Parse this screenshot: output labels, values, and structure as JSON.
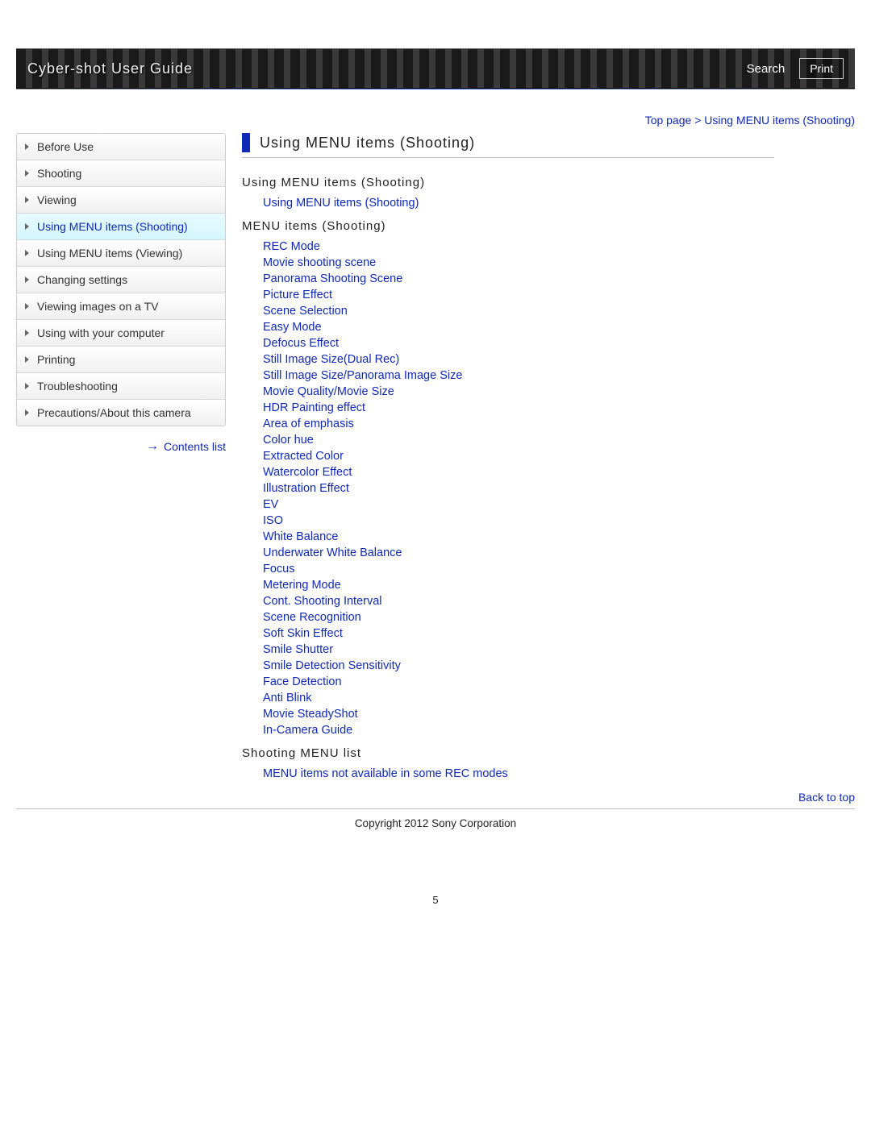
{
  "header": {
    "title": "Cyber-shot User Guide",
    "search": "Search",
    "print": "Print"
  },
  "breadcrumb": {
    "top": "Top page",
    "sep": " > ",
    "current": "Using MENU items (Shooting)"
  },
  "sidebar": {
    "items": [
      {
        "label": "Before Use",
        "active": false
      },
      {
        "label": "Shooting",
        "active": false
      },
      {
        "label": "Viewing",
        "active": false
      },
      {
        "label": "Using MENU items (Shooting)",
        "active": true
      },
      {
        "label": "Using MENU items (Viewing)",
        "active": false
      },
      {
        "label": "Changing settings",
        "active": false
      },
      {
        "label": "Viewing images on a TV",
        "active": false
      },
      {
        "label": "Using with your computer",
        "active": false
      },
      {
        "label": "Printing",
        "active": false
      },
      {
        "label": "Troubleshooting",
        "active": false
      },
      {
        "label": "Precautions/About this camera",
        "active": false
      }
    ],
    "contents_list": "Contents list"
  },
  "main": {
    "title": "Using MENU items (Shooting)",
    "section1": {
      "heading": "Using MENU items (Shooting)",
      "links": [
        "Using MENU items (Shooting)"
      ]
    },
    "section2": {
      "heading": "MENU items (Shooting)",
      "links": [
        "REC Mode",
        "Movie shooting scene",
        "Panorama Shooting Scene",
        "Picture Effect",
        "Scene Selection",
        "Easy Mode",
        "Defocus Effect",
        "Still Image Size(Dual Rec)",
        "Still Image Size/Panorama Image Size",
        "Movie Quality/Movie Size",
        "HDR Painting effect",
        "Area of emphasis",
        "Color hue",
        "Extracted Color",
        "Watercolor Effect",
        "Illustration Effect",
        "EV",
        "ISO",
        "White Balance",
        "Underwater White Balance",
        "Focus",
        "Metering Mode",
        "Cont. Shooting Interval",
        "Scene Recognition",
        "Soft Skin Effect",
        "Smile Shutter",
        "Smile Detection Sensitivity",
        "Face Detection",
        "Anti Blink",
        "Movie SteadyShot",
        "In-Camera Guide"
      ]
    },
    "section3": {
      "heading": "Shooting MENU list",
      "links": [
        "MENU items not available in some REC modes"
      ]
    }
  },
  "footer": {
    "back_to_top": "Back to top",
    "copyright": "Copyright 2012 Sony Corporation",
    "page_number": "5"
  }
}
